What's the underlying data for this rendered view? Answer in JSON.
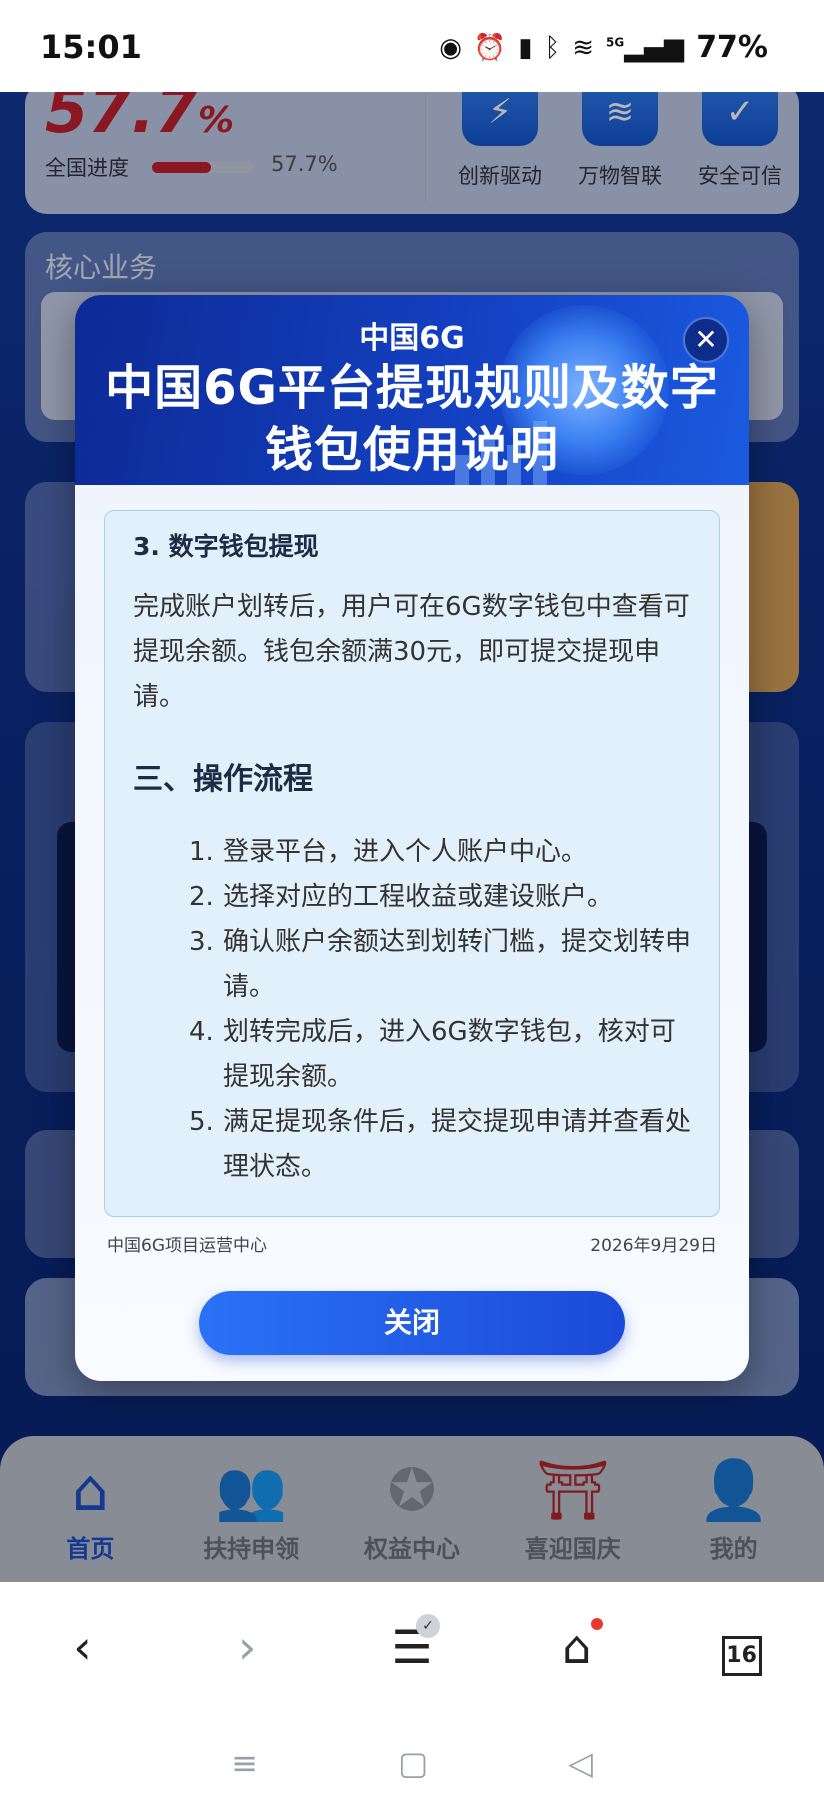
{
  "status_bar": {
    "time": "15:01",
    "battery": "77%",
    "network": "5G"
  },
  "background": {
    "progress": {
      "percent_display": "57.7",
      "percent_sign": "%",
      "label": "全国进度",
      "value_text": "57.7%",
      "fraction": 0.577
    },
    "features": [
      {
        "label": "创新驱动",
        "icon": "bolt-icon"
      },
      {
        "label": "万物智联",
        "icon": "wifi-icon"
      },
      {
        "label": "安全可信",
        "icon": "shield-check-icon"
      }
    ],
    "core_title": "核心业务"
  },
  "modal": {
    "brand": "中国6G",
    "title": "中国6G平台提现规则及数字钱包使用说明",
    "section_heading": "3. 数字钱包提现",
    "section_text": "完成账户划转后，用户可在6G数字钱包中查看可提现余额。钱包余额满30元，即可提交提现申请。",
    "process_heading": "三、操作流程",
    "steps": [
      "登录平台，进入个人账户中心。",
      "选择对应的工程收益或建设账户。",
      "确认账户余额达到划转门槛，提交划转申请。",
      "划转完成后，进入6G数字钱包，核对可提现余额。",
      "满足提现条件后，提交提现申请并查看处理状态。"
    ],
    "footer_org": "中国6G项目运营中心",
    "footer_date": "2026年9月29日",
    "close_label": "关闭"
  },
  "tab_bar": [
    {
      "label": "首页",
      "icon": "home-icon",
      "active": true
    },
    {
      "label": "扶持申领",
      "icon": "users-icon",
      "active": false
    },
    {
      "label": "权益中心",
      "icon": "badge-star-icon",
      "active": false
    },
    {
      "label": "喜迎国庆",
      "icon": "tiananmen-icon",
      "active": false
    },
    {
      "label": "我的",
      "icon": "person-icon",
      "active": false
    }
  ],
  "browser_bar": {
    "tabs_count": "16"
  },
  "colors": {
    "primary": "#1d4fc7",
    "accent_red": "#c0202f",
    "modal_header": "#1340c0"
  }
}
